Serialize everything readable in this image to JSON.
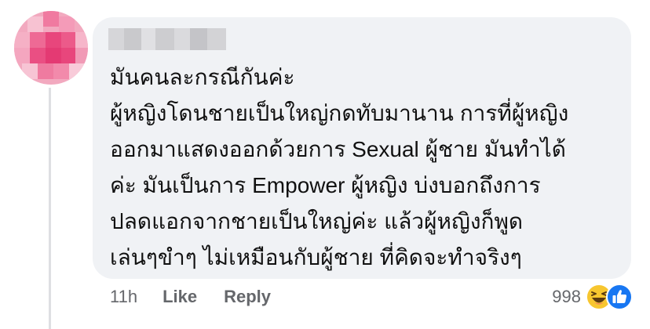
{
  "comment": {
    "text_lines": [
      "มันคนละกรณีกันค่ะ",
      "ผู้หญิงโดนชายเป็นใหญ่กดทับมานาน การที่ผู้หญิง",
      "ออกมาแสดงออกด้วยการ Sexual ผู้ชาย มันทำได้",
      "ค่ะ มันเป็นการ Empower ผู้หญิง บ่งบอกถึงการ",
      "ปลดแอกจากชายเป็นใหญ่ค่ะ แล้วผู้หญิงก็พูด",
      "เล่นๆขำๆ ไม่เหมือนกับผู้ชาย ที่คิดจะทำจริงๆ"
    ],
    "timestamp": "11h",
    "like_label": "Like",
    "reply_label": "Reply",
    "reaction_count": "998",
    "reaction_icons": [
      "haha-icon",
      "like-icon"
    ]
  },
  "colors": {
    "bubble": "#f0f2f5",
    "text": "#111111",
    "meta": "#65676b",
    "avatar_pink": "#e8467c",
    "like_blue": "#1877f2",
    "haha_yellow": "#f7c62f"
  }
}
